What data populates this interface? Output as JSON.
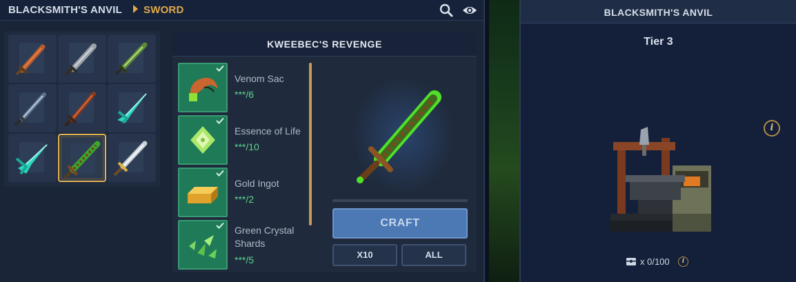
{
  "header": {
    "breadcrumb_root": "BLACKSMITH'S ANVIL",
    "breadcrumb_current": "SWORD",
    "icons": [
      "search-icon",
      "eye-icon"
    ]
  },
  "item_grid": {
    "items": [
      {
        "icon": "copper-sword-icon",
        "selected": false
      },
      {
        "icon": "iron-sword-icon",
        "selected": false
      },
      {
        "icon": "thorium-sword-icon",
        "selected": false
      },
      {
        "icon": "cobalt-sword-icon",
        "selected": false
      },
      {
        "icon": "adamantite-sword-icon",
        "selected": false
      },
      {
        "icon": "crystal-blade-icon",
        "selected": false
      },
      {
        "icon": "crystal-blade-icon",
        "selected": false
      },
      {
        "icon": "kweebecs-revenge-icon",
        "selected": true
      },
      {
        "icon": "silver-sword-icon",
        "selected": false
      }
    ]
  },
  "recipe": {
    "title": "KWEEBEC'S REVENGE",
    "ingredients": [
      {
        "name": "Venom Sac",
        "count": "***/6",
        "icon": "venom-sac-icon",
        "has": true
      },
      {
        "name": "Essence of Life",
        "count": "***/10",
        "icon": "essence-of-life-icon",
        "has": true
      },
      {
        "name": "Gold Ingot",
        "count": "***/2",
        "icon": "gold-ingot-icon",
        "has": true
      },
      {
        "name": "Green Crystal Shards",
        "count": "***/5",
        "icon": "green-crystal-shards-icon",
        "has": true
      }
    ],
    "craft_label": "CRAFT",
    "x10_label": "X10",
    "all_label": "ALL"
  },
  "side_panel": {
    "title": "BLACKSMITH'S ANVIL",
    "tier": "Tier 3",
    "info_glyph": "i",
    "storage_text": "x 0/100",
    "storage_icon": "chest-icon"
  },
  "colors": {
    "accent_gold": "#e0a94a",
    "craft_blue": "#4c79b4",
    "count_green": "#5ed48e",
    "ingredient_tile": "#1e7a57"
  }
}
